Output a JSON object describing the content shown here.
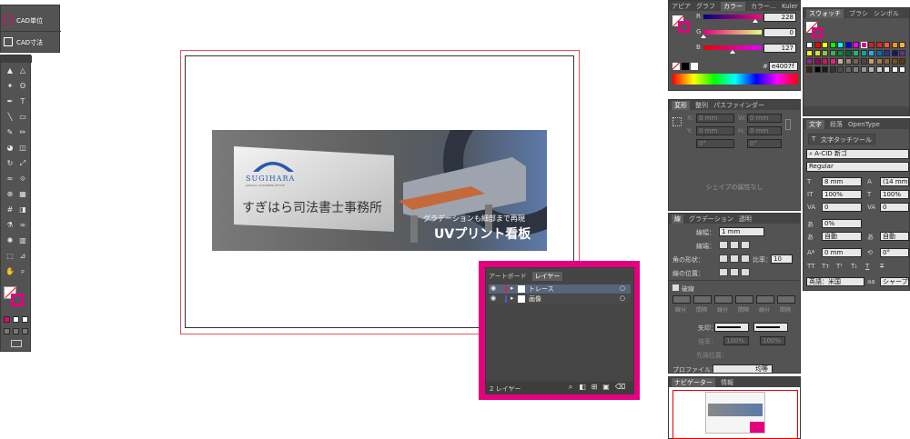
{
  "cad_panel": {
    "items": [
      {
        "label": "CAD単位"
      },
      {
        "label": "CAD寸法"
      }
    ]
  },
  "toolbar": {
    "tools": [
      "selection",
      "direct-selection",
      "magic-wand",
      "lasso",
      "pen",
      "type",
      "line",
      "rectangle",
      "paintbrush",
      "pencil",
      "blob-brush",
      "eraser",
      "rotate",
      "scale",
      "warp",
      "free-transform",
      "shape-builder",
      "perspective-grid",
      "mesh",
      "gradient",
      "eyedropper",
      "blend",
      "symbol-sprayer",
      "column-graph",
      "artboard",
      "slice",
      "hand",
      "zoom"
    ]
  },
  "artwork": {
    "company_name": "すぎはら司法書士事務所",
    "logo_text": "SUGIHARA",
    "logo_sub": "JUDICIAL SCRIVENER OFFICE",
    "tagline": "グラデーションも細部まで再現",
    "headline": "UVプリント看板"
  },
  "layers_panel": {
    "tabs": [
      {
        "label": "アートボード"
      },
      {
        "label": "レイヤー"
      }
    ],
    "layers": [
      {
        "name": "トレース",
        "color": "#e0204a"
      },
      {
        "name": "画像",
        "color": "#4a5ae0"
      }
    ],
    "count_label": "2 レイヤー",
    "highlight_color": "#e4007f"
  },
  "color_panel": {
    "tabs": [
      {
        "label": "アピア"
      },
      {
        "label": "グラフ"
      },
      {
        "label": "カラー"
      },
      {
        "label": "カラー…"
      },
      {
        "label": "Kuler"
      }
    ],
    "channels": [
      {
        "name": "R",
        "value": "228"
      },
      {
        "name": "G",
        "value": "0"
      },
      {
        "name": "B",
        "value": "127"
      }
    ],
    "hex_label": "#",
    "hex": "e4007f",
    "fill_color": "#e4007f"
  },
  "transform_panel": {
    "tabs": [
      {
        "label": "変形"
      },
      {
        "label": "整列"
      },
      {
        "label": "パスファインダー"
      }
    ],
    "fields": [
      {
        "label": "X:",
        "value": "0 mm"
      },
      {
        "label": "W:",
        "value": "0 mm"
      },
      {
        "label": "Y:",
        "value": "0 mm"
      },
      {
        "label": "H:",
        "value": "0 mm"
      }
    ],
    "rotate_value": "0°",
    "shear_value": "0°",
    "empty_text": "シェイプの属性なし"
  },
  "stroke_panel": {
    "tabs": [
      {
        "label": "線"
      },
      {
        "label": "グラデーション"
      },
      {
        "label": "透明"
      }
    ],
    "weight_label": "線幅：",
    "weight_value": "1 mm",
    "cap_label": "線端：",
    "corner_label": "角の形状：",
    "limit_label": "比率：",
    "limit_value": "10",
    "align_label": "線の位置：",
    "dashed_label": "破線",
    "dash_cols": [
      {
        "label": "線分"
      },
      {
        "label": "間隔"
      },
      {
        "label": "線分"
      },
      {
        "label": "間隔"
      },
      {
        "label": "線分"
      },
      {
        "label": "間隔"
      }
    ],
    "arrow_label": "矢印：",
    "scale_label": "倍率：",
    "scale_values": [
      "100%",
      "100%"
    ],
    "align_arrow_label": "先端位置：",
    "profile_label": "プロファイル：",
    "profile_value": "均等"
  },
  "navigator_panel": {
    "tabs": [
      {
        "label": "ナビゲーター"
      },
      {
        "label": "情報"
      }
    ]
  },
  "swatches_panel": {
    "tabs": [
      {
        "label": "スウォッチ"
      },
      {
        "label": "ブラシ"
      },
      {
        "label": "シンボル"
      }
    ],
    "colors": [
      "#ffffff",
      "#ff0000",
      "#ffff00",
      "#00ff00",
      "#00ffff",
      "#0000ff",
      "#ff00ff",
      "#e4007f",
      "#c1272d",
      "#ed1c24",
      "#f15a24",
      "#f7931e",
      "#fbb03b",
      "#fcee21",
      "#d9e021",
      "#8cc63f",
      "#39b54a",
      "#009245",
      "#006837",
      "#22b573",
      "#00a99d",
      "#29abe2",
      "#0071bc",
      "#2e3192",
      "#1b1464",
      "#662d91",
      "#93278f",
      "#9e005d",
      "#d4145a",
      "#ed1e79",
      "#c7b299",
      "#998675",
      "#736357",
      "#534741",
      "#c69c6d",
      "#a67c52",
      "#8c6239",
      "#754c24",
      "#603813",
      "#42210b",
      "#000000",
      "#1a1a1a",
      "#333333",
      "#4d4d4d",
      "#666666",
      "#808080",
      "#999999",
      "#b3b3b3",
      "#cccccc",
      "#e6e6e6",
      "#f2f2f2",
      "#ffffff"
    ]
  },
  "character_panel": {
    "tabs": [
      {
        "label": "文字"
      },
      {
        "label": "段落"
      },
      {
        "label": "OpenType"
      }
    ],
    "touch_tool_label": "文字タッチツール",
    "font_family": "A-CID 新ゴ",
    "font_style": "Regular",
    "size": "8 mm",
    "leading": "(14 mm)",
    "v_scale": "100%",
    "h_scale": "100%",
    "kerning": "0",
    "tracking": "0",
    "tsume": "0%",
    "aki_left": "自動",
    "aki_right": "自動",
    "baseline": "0 mm",
    "char_rotate": "0°",
    "language": "英語：米国",
    "antialias": "シャープ"
  }
}
